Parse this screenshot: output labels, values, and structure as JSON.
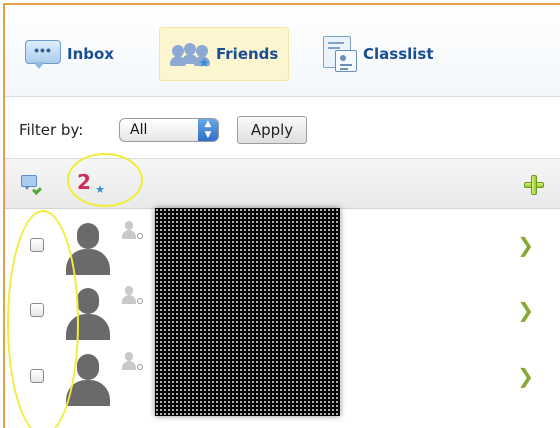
{
  "tabs": [
    {
      "label": "Inbox",
      "icon": "speech-bubble-icon",
      "active": false
    },
    {
      "label": "Friends",
      "icon": "friends-icon",
      "active": true
    },
    {
      "label": "Classlist",
      "icon": "classlist-card-icon",
      "active": false
    }
  ],
  "filter": {
    "label": "Filter by:",
    "selected": "All",
    "apply_label": "Apply"
  },
  "toolbar": {
    "friend_badge_text": "2",
    "icons": [
      "message-add-icon",
      "friend-request-icon",
      "add-icon"
    ]
  },
  "colors": {
    "accent_border": "#e8a04a",
    "tab_text": "#1b4e95",
    "active_tab_bg": "#fbf6cf",
    "annotation": "#f0ee38",
    "chevron": "#86a836"
  },
  "friend_rows": [
    {
      "checked": false,
      "avatar": "default-avatar",
      "status": "offline"
    },
    {
      "checked": false,
      "avatar": "default-avatar",
      "status": "offline"
    },
    {
      "checked": false,
      "avatar": "default-avatar",
      "status": "offline"
    }
  ]
}
